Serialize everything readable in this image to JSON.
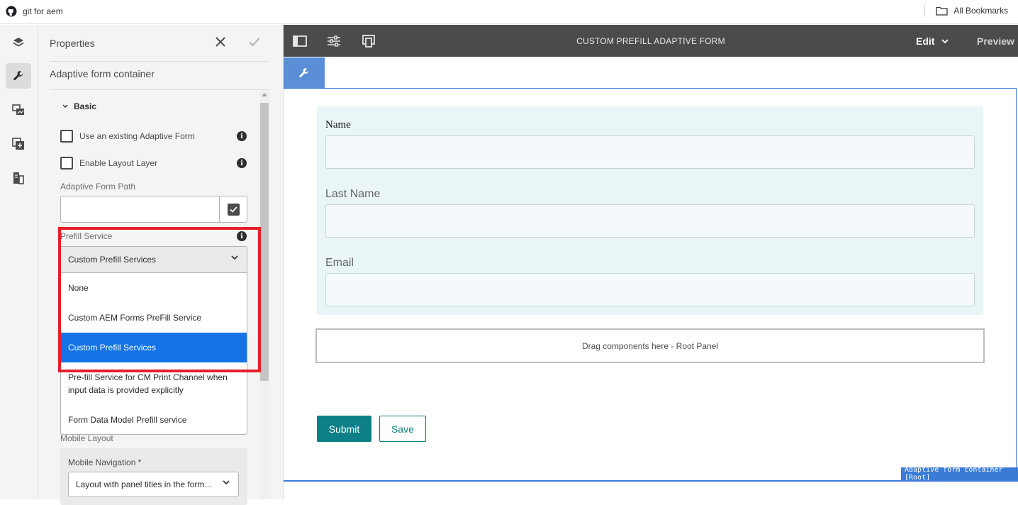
{
  "bookmarks_bar": {
    "left_item": "git for aem",
    "right_item": "All Bookmarks"
  },
  "rail": {
    "items": [
      "layers-icon",
      "wrench-icon",
      "assets-icon",
      "components-icon",
      "content-tree-icon"
    ],
    "active": "wrench-icon"
  },
  "properties": {
    "title": "Properties",
    "subtitle": "Adaptive form container",
    "section": "Basic",
    "checkbox_existing": "Use an existing Adaptive Form",
    "checkbox_layout": "Enable Layout Layer",
    "form_path_label": "Adaptive Form Path",
    "form_path_value": "",
    "prefill_label": "Prefill Service",
    "prefill_selected": "Custom Prefill Services",
    "prefill_options": [
      "None",
      "Custom AEM Forms PreFill Service",
      "Custom Prefill Services",
      "Pre-fill Service for CM Print Channel when input data is provided explicitly",
      "Form Data Model Prefill service"
    ],
    "mobile_layout_label": "Mobile Layout",
    "mobile_nav_label": "Mobile Navigation *",
    "mobile_nav_value": "Layout with panel titles in the form..."
  },
  "toolbar": {
    "title": "CUSTOM PREFILL ADAPTIVE FORM",
    "edit": "Edit",
    "preview": "Preview"
  },
  "form": {
    "fields": [
      {
        "label": "Name",
        "value": ""
      },
      {
        "label": "Last Name",
        "value": ""
      },
      {
        "label": "Email",
        "value": ""
      }
    ],
    "drop_zone": "Drag components here - Root Panel",
    "submit": "Submit",
    "save": "Save",
    "root_badge": "Adaptive form container [Root]"
  },
  "colors": {
    "toolbar_bg": "#4b4b4b",
    "selected_option": "#1473e6",
    "highlight": "#e3202b",
    "submit_bg": "#0d7f86",
    "container_border": "#3a7bd5"
  }
}
